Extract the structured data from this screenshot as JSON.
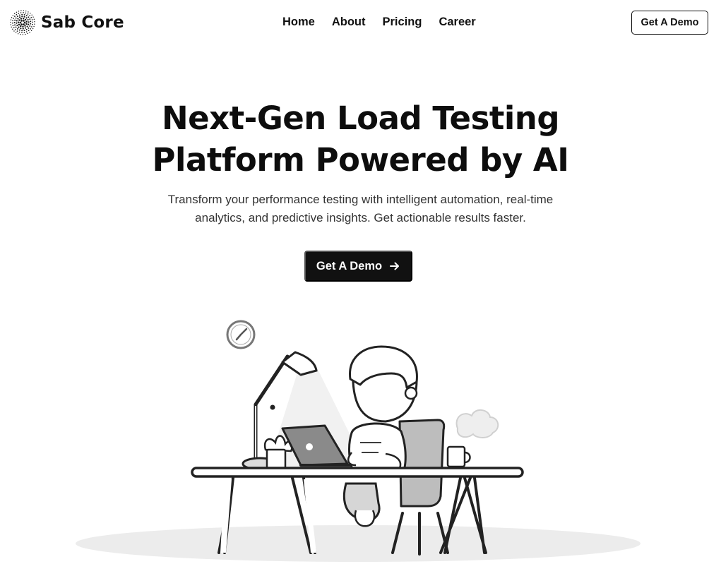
{
  "brand": {
    "name": "Sab Core",
    "logo_icon": "dotted-burst-logo-icon"
  },
  "nav": {
    "items": [
      {
        "label": "Home"
      },
      {
        "label": "About"
      },
      {
        "label": "Pricing"
      },
      {
        "label": "Career"
      }
    ],
    "cta_label": "Get A Demo"
  },
  "hero": {
    "title_line1": "Next-Gen Load Testing",
    "title_line2": "Platform Powered by AI",
    "subtitle_line1": "Transform your performance testing with intelligent automation, real-time",
    "subtitle_line2": "analytics, and predictive insights. Get actionable results faster.",
    "cta_label": "Get A Demo",
    "cta_icon": "arrow-right-icon"
  },
  "illustration": {
    "subject": "person-working-at-laptop-illustration"
  },
  "colors": {
    "primary": "#111111",
    "background": "#ffffff",
    "text_muted": "#333333"
  }
}
